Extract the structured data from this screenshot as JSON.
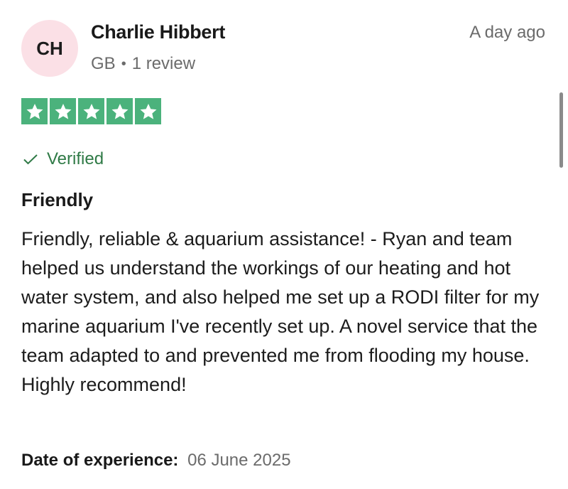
{
  "reviewer": {
    "initials": "CH",
    "name": "Charlie Hibbert",
    "country": "GB",
    "separator": "•",
    "review_count": "1 review",
    "avatar_color": "#fbe0e6"
  },
  "review": {
    "date_ago": "A day ago",
    "rating": 5,
    "rating_max": 5,
    "star_color": "#4bb27c",
    "verified_label": "Verified",
    "verified_icon": "check-icon",
    "title": "Friendly",
    "body": "Friendly, reliable & aquarium assistance! - Ryan and team helped us understand the workings of our heating and hot water system, and also helped me set up a RODI filter for my marine aquarium I've recently set up. A novel service that the team adapted to and prevented me from flooding my house. Highly recommend!",
    "experience_label": "Date of experience:",
    "experience_date": "06 June 2025"
  }
}
